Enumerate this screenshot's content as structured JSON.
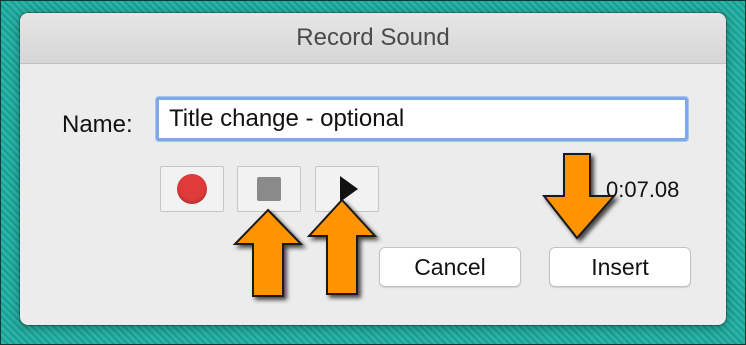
{
  "dialog": {
    "title": "Record Sound",
    "name_label": "Name:",
    "name_value": "Title change - optional",
    "elapsed_time": "0:07.08",
    "cancel_label": "Cancel",
    "insert_label": "Insert"
  },
  "controls": {
    "record_icon": "record-icon",
    "stop_icon": "stop-icon",
    "play_icon": "play-icon"
  },
  "colors": {
    "record": "#e03b3b",
    "annotation_arrow": "#ff9400",
    "background": "#1fa69a"
  }
}
